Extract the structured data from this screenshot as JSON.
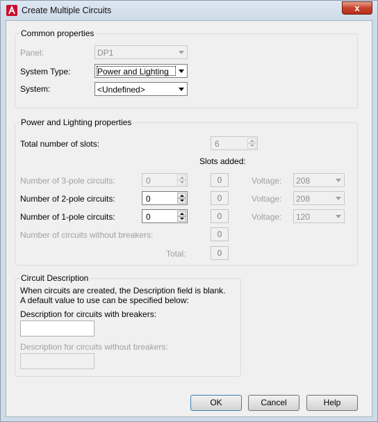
{
  "window": {
    "title": "Create Multiple Circuits",
    "close_symbol": "x",
    "app_icon": "autocad-red-a-icon",
    "app_icon_color": "#c8102e"
  },
  "common": {
    "legend": "Common properties",
    "panel_label": "Panel:",
    "panel_value": "DP1",
    "system_type_label": "System Type:",
    "system_type_value": "Power and Lighting",
    "system_label": "System:",
    "system_value": "<Undefined>"
  },
  "power": {
    "legend": "Power and Lighting properties",
    "total_slots_label": "Total number of slots:",
    "total_slots_value": "6",
    "slots_added_label": "Slots added:",
    "rows": [
      {
        "label": "Number of 3-pole circuits:",
        "value": "0",
        "slots": "0",
        "voltage_label": "Voltage:",
        "voltage": "208"
      },
      {
        "label": "Number of 2-pole circuits:",
        "value": "0",
        "slots": "0",
        "voltage_label": "Voltage:",
        "voltage": "208"
      },
      {
        "label": "Number of 1-pole circuits:",
        "value": "0",
        "slots": "0",
        "voltage_label": "Voltage:",
        "voltage": "120"
      }
    ],
    "no_breaker_label": "Number of circuits without breakers:",
    "no_breaker_value": "0",
    "total_label": "Total:",
    "total_value": "0"
  },
  "description": {
    "legend": "Circuit Description",
    "info_line1": "When circuits are created, the Description field is blank.",
    "info_line2": "A default value to use can be specified below:",
    "with_breakers_label": "Description for circuits with breakers:",
    "with_breakers_value": "",
    "without_breakers_label": "Description for circuits without breakers:",
    "without_breakers_value": ""
  },
  "buttons": {
    "ok": "OK",
    "cancel": "Cancel",
    "help": "Help"
  }
}
